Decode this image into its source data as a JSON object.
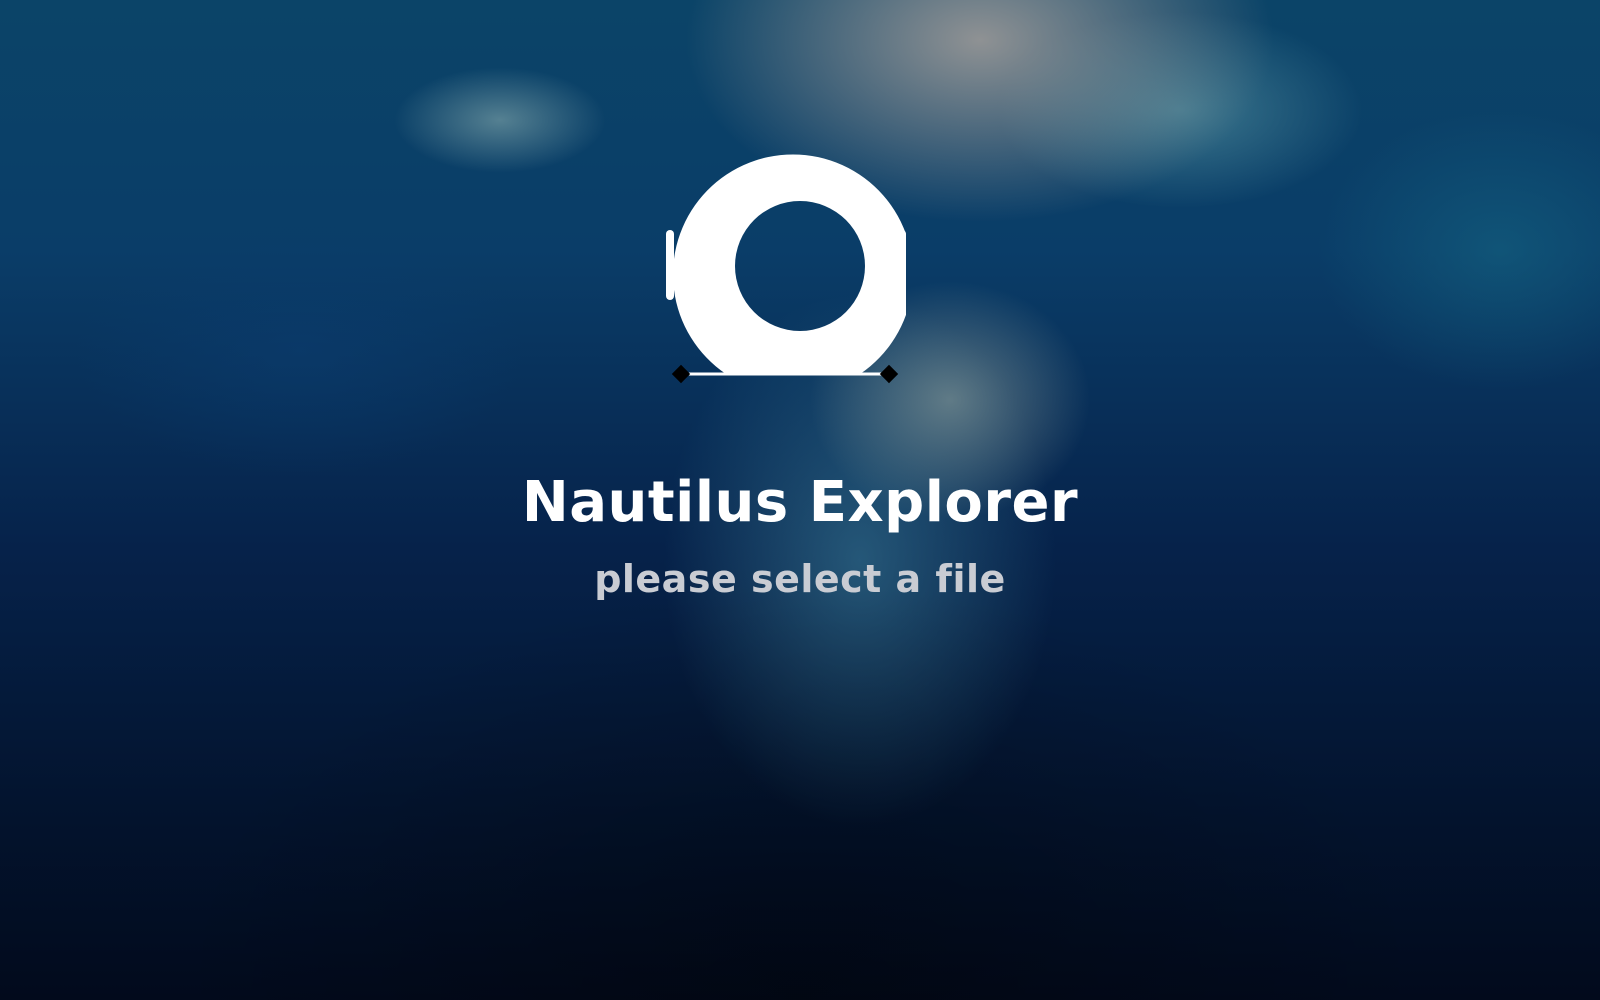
{
  "app": {
    "logo_icon": "nautilus-logo-icon",
    "title": "Nautilus Explorer",
    "subtitle": "please select a file"
  },
  "colors": {
    "title": "#ffffff",
    "subtitle": "#c9ccd3",
    "background_dark": "#03142f",
    "background_light": "#0b4468"
  }
}
